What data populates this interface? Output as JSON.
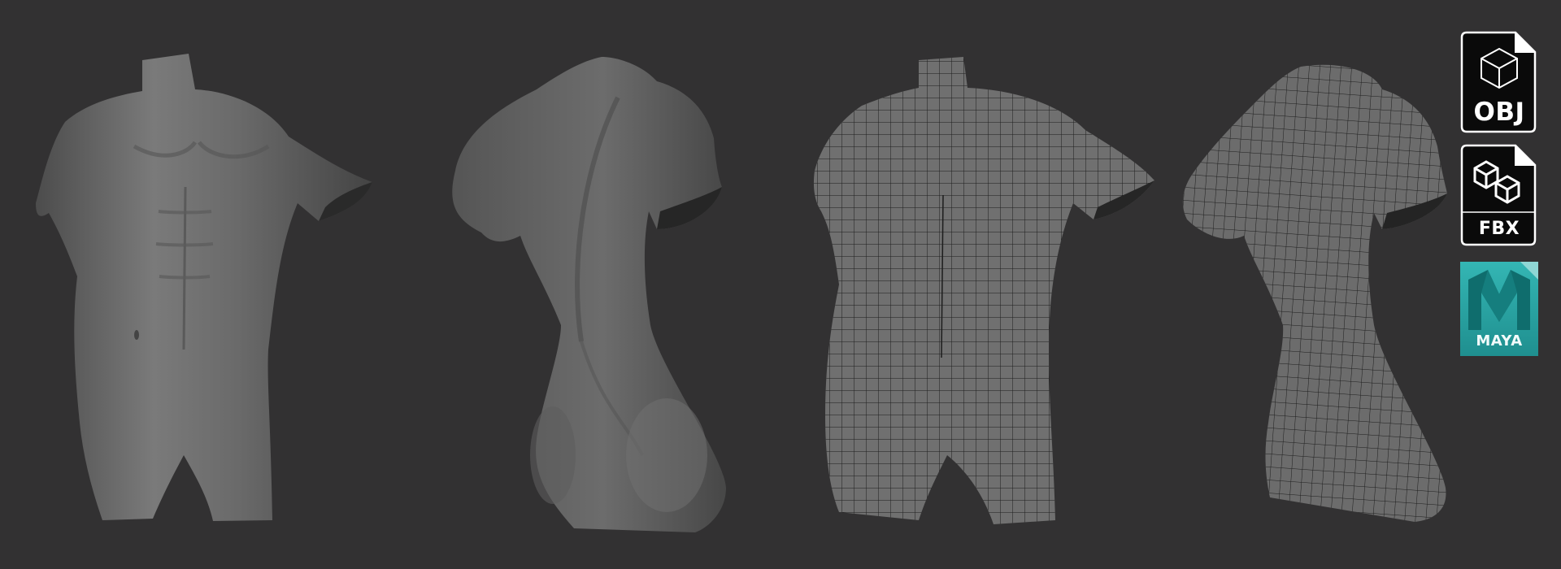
{
  "views": [
    {
      "name": "front-smooth",
      "shading": "smooth"
    },
    {
      "name": "back-smooth",
      "shading": "smooth"
    },
    {
      "name": "front-wireframe",
      "shading": "wireframe"
    },
    {
      "name": "back-wireframe",
      "shading": "wireframe"
    }
  ],
  "badges": {
    "obj": {
      "label": "OBJ",
      "icon": "cube-icon"
    },
    "fbx": {
      "label": "FBX",
      "icon": "cubes-icon"
    },
    "maya": {
      "label": "MAYA",
      "icon": "maya-logo",
      "color": "#2aa7a6"
    }
  },
  "colors": {
    "background": "#323132",
    "mesh": "#6f6f6f",
    "wire": "#1b1b1b"
  }
}
